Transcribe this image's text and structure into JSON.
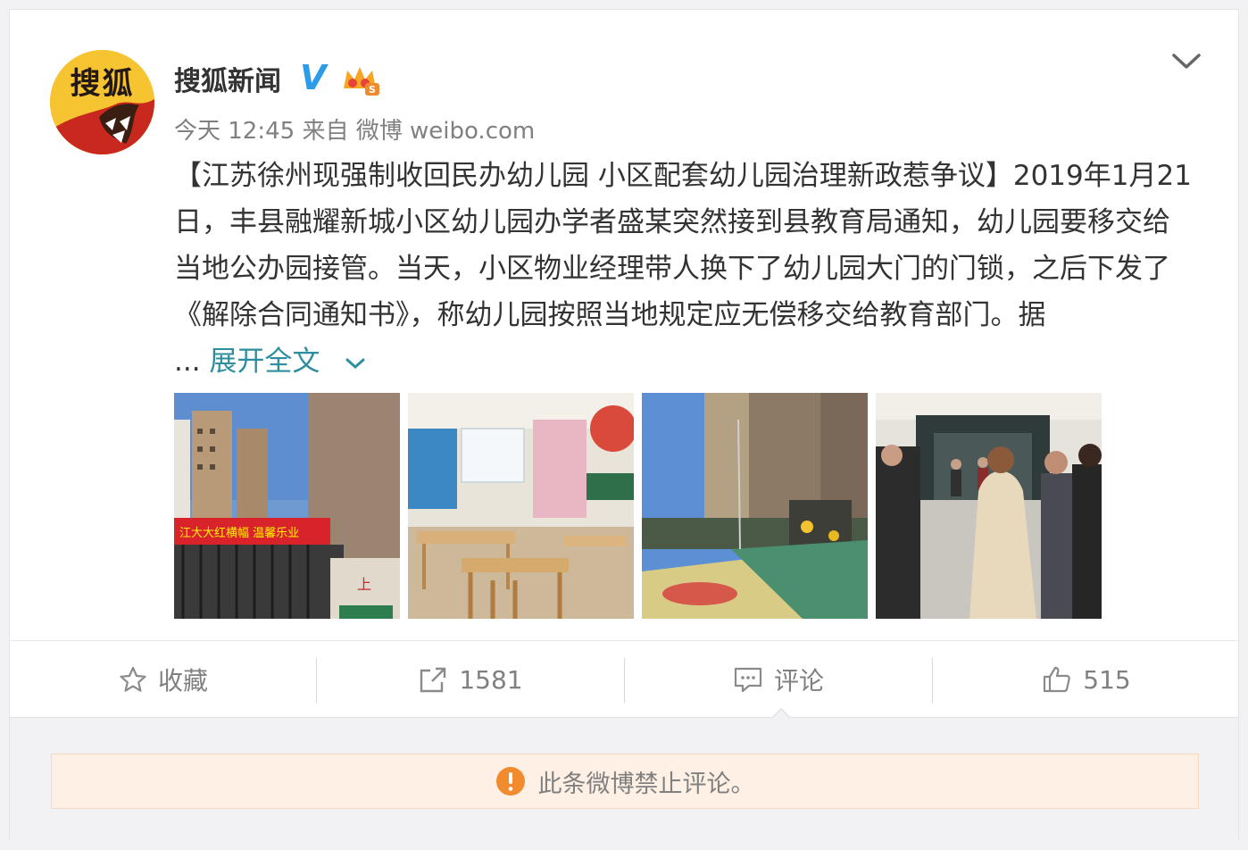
{
  "post": {
    "avatar_text": "搜狐",
    "username": "搜狐新闻",
    "verified_badge": "V",
    "meta": "今天 12:45 来自 微博 weibo.com",
    "content": "【江苏徐州现强制收回民办幼儿园 小区配套幼儿园治理新政惹争议】2019年1月21日，丰县融耀新城小区幼儿园办学者盛某突然接到县教育局通知，幼儿园要移交给当地公办园接管。当天，小区物业经理带人换下了幼儿园大门的门锁，之后下发了《解除合同通知书》，称幼儿园按照当地规定应无偿移交给教育部门。据",
    "ellipsis": "...",
    "expand_label": "展开全文"
  },
  "photos": [
    {
      "icon": "photo-building-gate"
    },
    {
      "icon": "photo-classroom"
    },
    {
      "icon": "photo-playground"
    },
    {
      "icon": "photo-crowd-entrance"
    }
  ],
  "actions": {
    "favorite_label": "收藏",
    "repost_count": "1581",
    "comment_label": "评论",
    "like_count": "515"
  },
  "comments": {
    "notice": "此条微博禁止评论。"
  },
  "colors": {
    "link": "#2e8e9e",
    "verified": "#2c9ce8",
    "warning": "#f28a2e",
    "notice_bg": "#fef0e4"
  }
}
